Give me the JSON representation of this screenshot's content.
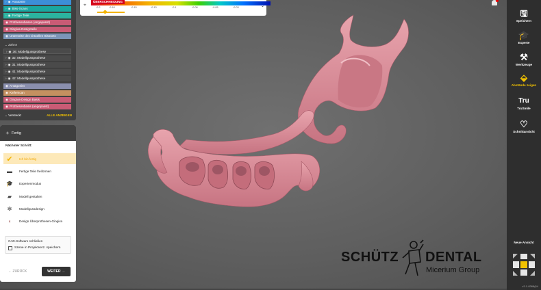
{
  "scene_tree": {
    "items": [
      {
        "label": "Anatomie",
        "color": "#3c8ed8"
      },
      {
        "label": "Biss-Scans",
        "color": "#1aa7a0"
      },
      {
        "label": "Fertige Teile",
        "color": "#2bb3a0"
      },
      {
        "label": "Prothesenbasen (angepasst)",
        "color": "#c95b75"
      },
      {
        "label": "Gingiva-Designteile",
        "color": "#c95b75"
      },
      {
        "label": "Unterseite des virtuellen Bisssets",
        "color": "#7b95b8"
      }
    ],
    "teeth_header": "Zähne",
    "teeth": [
      {
        "label": "36: Modellgussprothese",
        "color": "#4a4a4a"
      },
      {
        "label": "32: Modellgussprothese",
        "color": "#4a4a4a"
      },
      {
        "label": "31: Modellgussprothese",
        "color": "#4a4a4a"
      },
      {
        "label": "41: Modellgussprothese",
        "color": "#4a4a4a"
      },
      {
        "label": "42: Modellgussprothese",
        "color": "#4a4a4a"
      }
    ],
    "extra": [
      {
        "label": "Antagonist",
        "color": "#8a8fae"
      },
      {
        "label": "Kieferscan",
        "color": "#c49060"
      },
      {
        "label": "Gingiva-Design Basis",
        "color": "#c95b75"
      },
      {
        "label": "Prothesenbasis (angepasst)",
        "color": "#c95b75"
      }
    ],
    "hidden_label": "Versteckt",
    "show_all_label": "ALLE ANZEIGEN"
  },
  "step_panel": {
    "title": "Fertig",
    "next_step_label": "Nächster Schritt:",
    "steps": [
      {
        "label": "Ich bin fertig",
        "icon": "checkmark-icon"
      },
      {
        "label": "Fertige Teile freiformen",
        "icon": "freeform-icon"
      },
      {
        "label": "Expertenmodus",
        "icon": "expert-icon"
      },
      {
        "label": "Modell gestalten",
        "icon": "model-icon"
      },
      {
        "label": "Modellgussdesign",
        "icon": "framework-icon"
      },
      {
        "label": "Design Überprothesen-Gingiva",
        "icon": "gingiva-icon"
      }
    ],
    "close_cad_label": "CAD-Software schließen",
    "save_scene_label": "Szene in Projektverz. speichern",
    "back_label": "← ZURÜCK",
    "next_label": "WEITER →"
  },
  "legend": {
    "title": "ÜBERSCHNEIDUNG",
    "ticks": [
      "-0.2",
      "-0.18",
      "-0.15",
      "-0.13",
      "-0.1",
      "-0.08",
      "-0.05",
      "-0.03"
    ]
  },
  "toolbar": {
    "tools": [
      {
        "label": "Speichern",
        "icon": "save-icon"
      },
      {
        "label": "Experte",
        "icon": "expert-hat-icon"
      },
      {
        "label": "Werkzeuge",
        "icon": "tools-icon"
      },
      {
        "label": "Abstände zeigen",
        "icon": "distance-icon"
      },
      {
        "label": "TruSmile",
        "icon": "trusmile-icon",
        "glyph": "Tru"
      },
      {
        "label": "Schnittansicht",
        "icon": "section-view-icon"
      }
    ],
    "view_label": "Neue Ansicht",
    "version": "v3.1-8368(64"
  },
  "logo": {
    "word1": "SCHÜTZ",
    "word2": "DENTAL",
    "word3": "Micerium Group"
  },
  "colors": {
    "accent": "#f2c200",
    "model": "#d98b98",
    "viewport": "#646464",
    "toolbar": "#2e2e2e"
  }
}
